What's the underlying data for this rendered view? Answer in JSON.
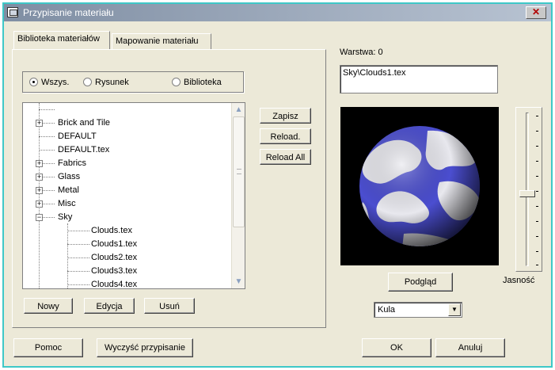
{
  "window": {
    "title": "Przypisanie materiału",
    "close_glyph": "✕"
  },
  "tabs": [
    {
      "label": "Biblioteka materiałów",
      "active": true
    },
    {
      "label": "Mapowanie materiału",
      "active": false
    }
  ],
  "filter": {
    "options": [
      {
        "label": "Wszys.",
        "selected": true
      },
      {
        "label": "Rysunek",
        "selected": false
      },
      {
        "label": "Biblioteka",
        "selected": false
      }
    ]
  },
  "tree": {
    "items": [
      {
        "label": "Brick and Tile",
        "expander": "+"
      },
      {
        "label": "DEFAULT",
        "expander": ""
      },
      {
        "label": "DEFAULT.tex",
        "expander": ""
      },
      {
        "label": "Fabrics",
        "expander": "+"
      },
      {
        "label": "Glass",
        "expander": "+"
      },
      {
        "label": "Metal",
        "expander": "+"
      },
      {
        "label": "Misc",
        "expander": "+"
      },
      {
        "label": "Sky",
        "expander": "−"
      }
    ],
    "children": [
      {
        "label": "Clouds.tex"
      },
      {
        "label": "Clouds1.tex"
      },
      {
        "label": "Clouds2.tex"
      },
      {
        "label": "Clouds3.tex"
      },
      {
        "label": "Clouds4.tex"
      }
    ]
  },
  "side_buttons": {
    "save": "Zapisz",
    "reload": "Reload.",
    "reload_all": "Reload All"
  },
  "bottom_tab_buttons": {
    "new": "Nowy",
    "edit": "Edycja",
    "delete": "Usuń"
  },
  "layer": {
    "label": "Warstwa: 0",
    "path_value": "Sky\\Clouds1.tex"
  },
  "preview": {
    "button": "Podgląd",
    "shape_selected": "Kula",
    "brightness_label": "Jasność",
    "brightness_level": 0.5,
    "sphere_colors": {
      "blue": "#4b4ed0",
      "cloud": "#e8e8ee"
    }
  },
  "footer": {
    "help": "Pomoc",
    "clear": "Wyczyść przypisanie",
    "ok": "OK",
    "cancel": "Anuluj"
  }
}
